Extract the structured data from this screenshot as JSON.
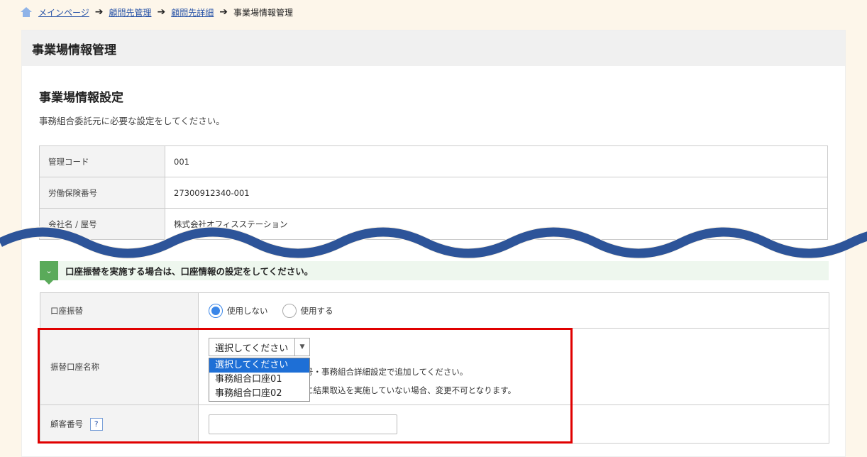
{
  "breadcrumb": {
    "items": [
      "メインページ",
      "顧問先管理",
      "顧問先詳細"
    ],
    "current": "事業場情報管理"
  },
  "page_title": "事業場情報管理",
  "section": {
    "title": "事業場情報設定",
    "description": "事務組合委託元に必要な設定をしてください。"
  },
  "info_table": [
    {
      "label": "管理コード",
      "value": "001"
    },
    {
      "label": "労働保険番号",
      "value": "27300912340-001"
    },
    {
      "label": "会社名 / 屋号",
      "value": "株式会社オフィスステーション"
    }
  ],
  "notice": {
    "text": "口座振替を実施する場合は、口座情報の設定をしてください。"
  },
  "bank": {
    "transfer_label": "口座振替",
    "radio_off": "使用しない",
    "radio_on": "使用する",
    "selected_radio": "使用しない",
    "account_label": "振替口座名称",
    "select_value": "選択してください",
    "options": [
      "選択してください",
      "事務組合口座01",
      "事務組合口座02"
    ],
    "help_line1": "号・事務組合詳細設定で追加してください。",
    "help_line2": "に結果取込を実施していない場合、変更不可となります。",
    "customer_label": "顧客番号",
    "help_icon": "?",
    "customer_value": ""
  },
  "colors": {
    "link": "#2a55a8",
    "notice_accent": "#5aaa5a",
    "selected_option": "#1e6fd6",
    "radio": "#3a86e8",
    "highlight_border": "#e00000",
    "wave": "#2d5499"
  }
}
